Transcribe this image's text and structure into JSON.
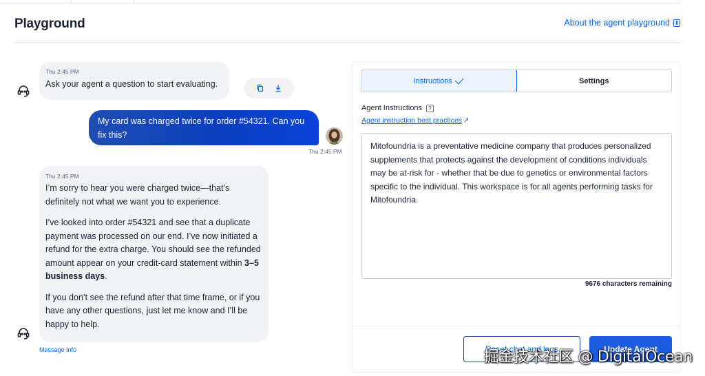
{
  "header": {
    "title": "Playground",
    "about_link": "About the agent playground",
    "about_icon": "book-icon"
  },
  "chat": {
    "messages": [
      {
        "role": "agent",
        "timestamp": "Thu 2:45 PM",
        "text": "Ask your agent a question to start evaluating."
      },
      {
        "role": "user",
        "timestamp": "Thu 2:45 PM",
        "text": "My card was charged twice for order #54321. Can you fix this?"
      },
      {
        "role": "agent",
        "timestamp": "Thu 2:45 PM",
        "paragraphs": [
          "I’m sorry to hear you were charged twice—that’s definitely not what we want you to experience.",
          "I’ve looked into order #54321 and see that a duplicate payment was processed on our end. I’ve now initiated a refund for the extra charge. You should see the refunded amount appear on your credit-card statement within ",
          "3–5 business days",
          ".",
          "If you don’t see the refund after that time frame, or if you have any other questions, just let me know and I’ll be happy to help."
        ]
      }
    ],
    "actions": {
      "copy_icon": "copy-icon",
      "download_icon": "download-icon"
    },
    "message_info": "Message Info"
  },
  "panel": {
    "tabs": [
      {
        "label": "Instructions",
        "active": true
      },
      {
        "label": "Settings",
        "active": false
      }
    ],
    "instructions_label": "Agent Instructions",
    "help_icon": "?",
    "best_practices_link": "Agent instruction best practices",
    "best_practices_arrow": "↗",
    "instructions_text": "Mitofoundria is a preventative medicine company that produces personalized supplements that protects against the development of conditions individuals may be at-risk for - whether that be due to genetics or environmental factors specific to the individual. This workspace is for all agents performing tasks for Mitofoundria.",
    "characters_remaining": "9676 characters remaining",
    "reset_button": "Reset chat and logs",
    "update_button": "Update Agent"
  },
  "watermark": "掘金技术社区 @ DigitalOcean",
  "colors": {
    "accent": "#0069ff",
    "user_bubble": "#0b3fbf",
    "agent_bubble": "#f1f3f7"
  }
}
